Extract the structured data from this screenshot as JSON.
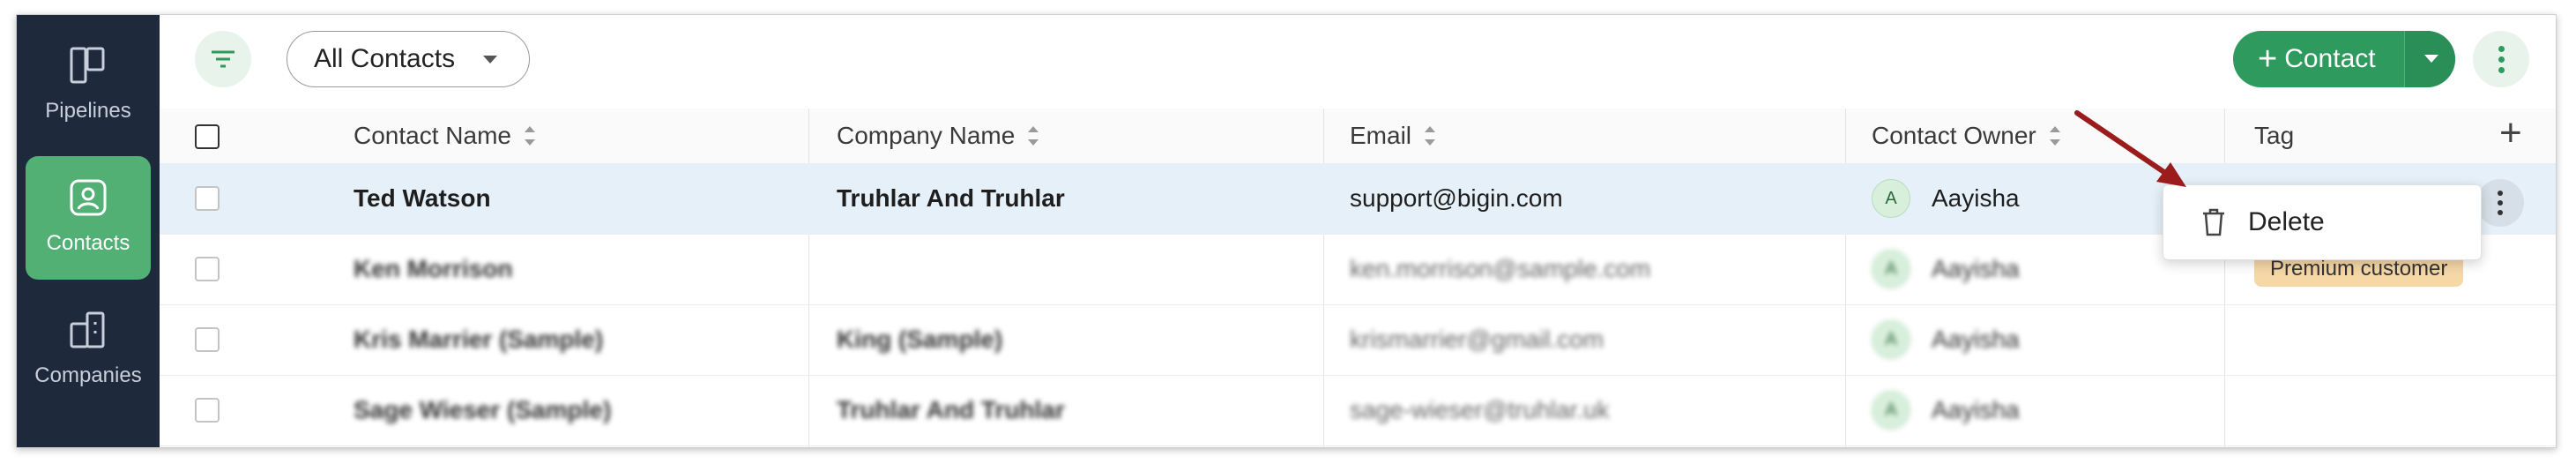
{
  "sidebar": {
    "items": [
      {
        "label": "Pipelines",
        "icon": "pipelines-icon",
        "active": false
      },
      {
        "label": "Contacts",
        "icon": "contacts-icon",
        "active": true
      },
      {
        "label": "Companies",
        "icon": "companies-icon",
        "active": false
      }
    ]
  },
  "toolbar": {
    "view_label": "All Contacts",
    "add_label": "Contact",
    "add_plus": "+"
  },
  "table": {
    "columns": [
      "Contact Name",
      "Company Name",
      "Email",
      "Contact Owner",
      "Tag"
    ],
    "rows": [
      {
        "name": "Ted Watson",
        "company": "Truhlar And Truhlar",
        "email": "support@bigin.com",
        "owner_initial": "A",
        "owner": "Aayisha",
        "tag": "",
        "highlighted": true
      },
      {
        "name": "Ken Morrison",
        "company": "",
        "email": "ken.morrison@sample.com",
        "owner_initial": "A",
        "owner": "Aayisha",
        "tag": "Premium customer",
        "highlighted": false
      },
      {
        "name": "Kris Marrier (Sample)",
        "company": "King (Sample)",
        "email": "krismarrier@gmail.com",
        "owner_initial": "A",
        "owner": "Aayisha",
        "tag": "",
        "highlighted": false
      },
      {
        "name": "Sage Wieser (Sample)",
        "company": "Truhlar And Truhlar",
        "email": "sage-wieser@truhlar.uk",
        "owner_initial": "A",
        "owner": "Aayisha",
        "tag": "",
        "highlighted": false
      }
    ]
  },
  "context_menu": {
    "items": [
      {
        "label": "Delete",
        "icon": "trash-icon"
      }
    ]
  },
  "colors": {
    "sidebar_bg": "#1e2a3c",
    "active_nav": "#52b075",
    "primary_green": "#2f9a5e",
    "highlight_row": "#e6f0f8",
    "tag_bg": "#f6d7a6",
    "annotation_arrow": "#9b1c1c"
  }
}
